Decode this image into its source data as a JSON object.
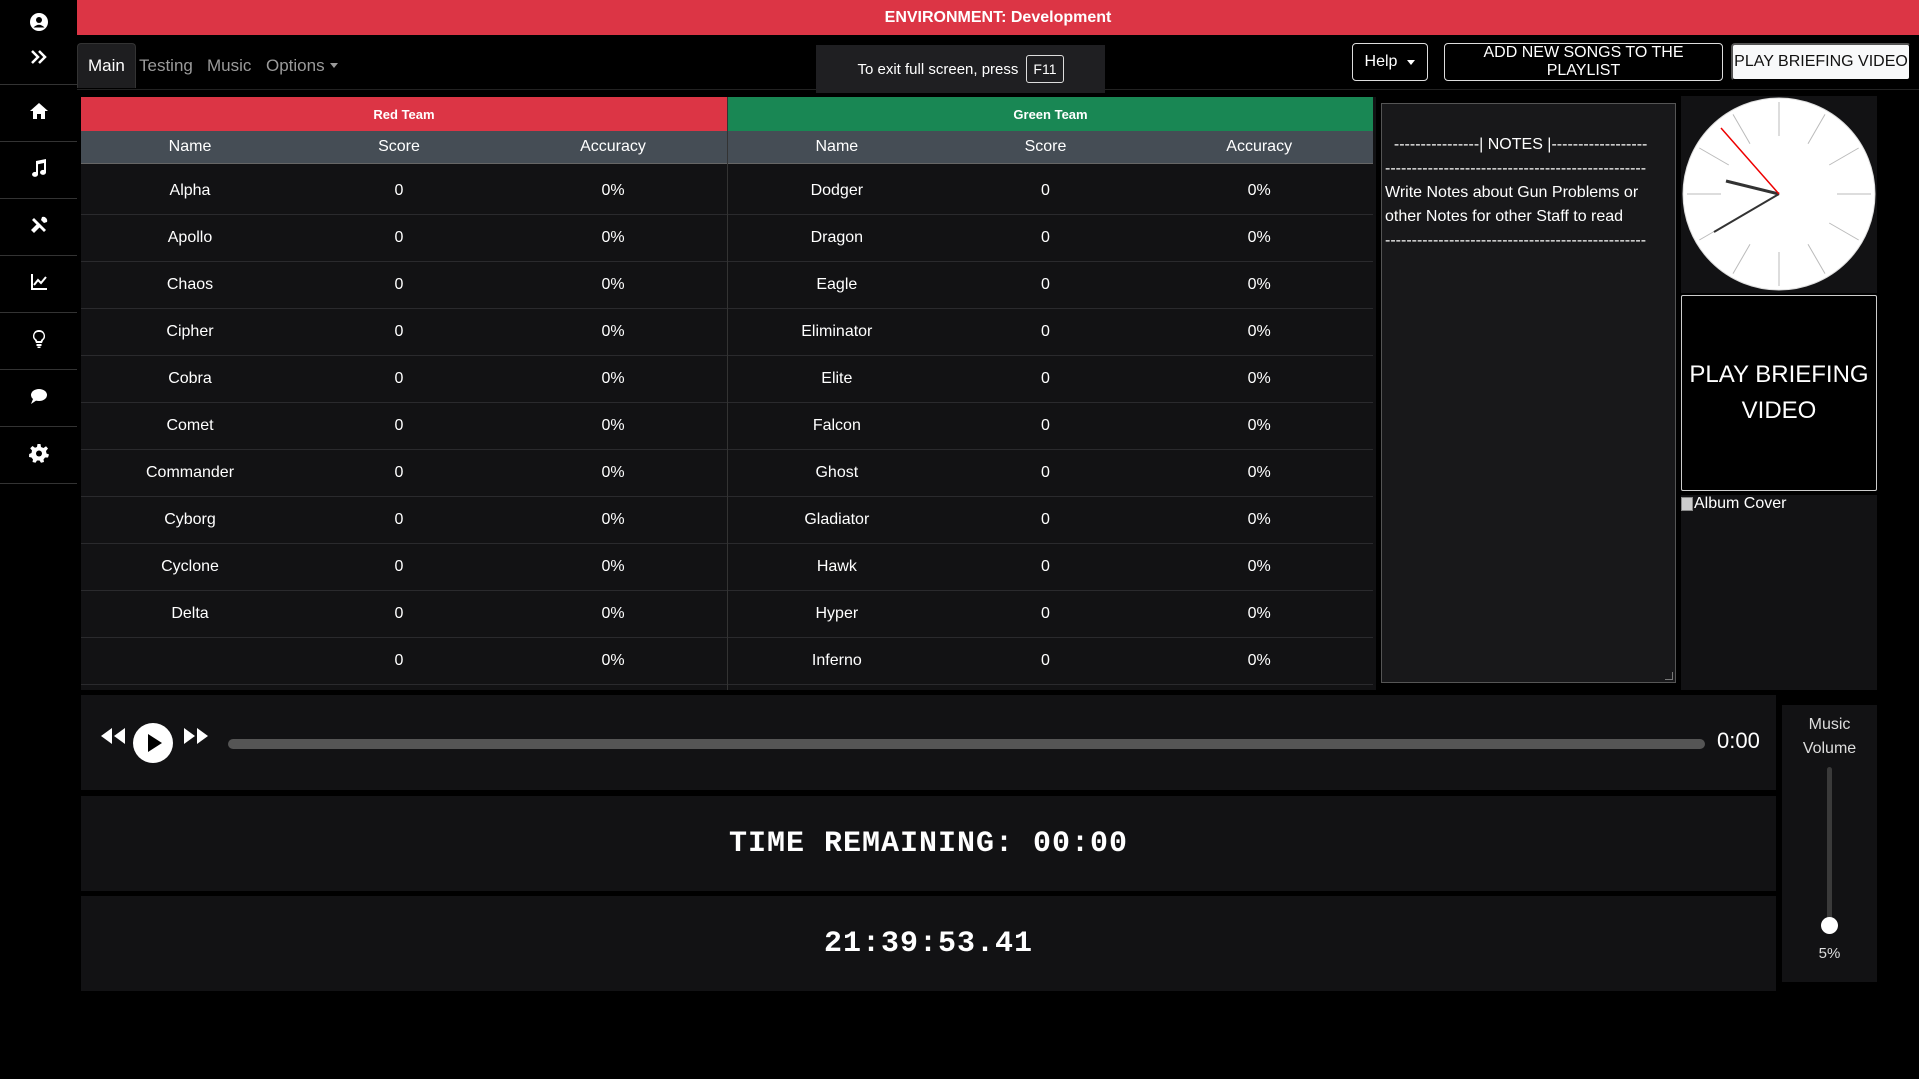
{
  "environment_banner": "ENVIRONMENT: Development",
  "nav": {
    "tabs": [
      "Main",
      "Testing",
      "Music"
    ],
    "options_label": "Options",
    "fullscreen_hint": "To exit full screen, press",
    "fullscreen_key": "F11",
    "help_label": "Help",
    "add_songs_label": "ADD NEW SONGS TO THE PLAYLIST",
    "play_briefing_label": "PLAY BRIEFING VIDEO"
  },
  "sidebar_icons": [
    "user-circle-icon",
    "double-chevron-right-icon",
    "home-icon",
    "music-icon",
    "tools-icon",
    "chart-line-icon",
    "lightbulb-icon",
    "chat-icon",
    "gear-icon"
  ],
  "teams": {
    "columns": [
      "Name",
      "Score",
      "Accuracy"
    ],
    "red": {
      "name": "Red Team",
      "color": "#dc3545",
      "players": [
        {
          "name": "Alpha",
          "score": "0",
          "accuracy": "0%"
        },
        {
          "name": "Apollo",
          "score": "0",
          "accuracy": "0%"
        },
        {
          "name": "Chaos",
          "score": "0",
          "accuracy": "0%"
        },
        {
          "name": "Cipher",
          "score": "0",
          "accuracy": "0%"
        },
        {
          "name": "Cobra",
          "score": "0",
          "accuracy": "0%"
        },
        {
          "name": "Comet",
          "score": "0",
          "accuracy": "0%"
        },
        {
          "name": "Commander",
          "score": "0",
          "accuracy": "0%"
        },
        {
          "name": "Cyborg",
          "score": "0",
          "accuracy": "0%"
        },
        {
          "name": "Cyclone",
          "score": "0",
          "accuracy": "0%"
        },
        {
          "name": "Delta",
          "score": "0",
          "accuracy": "0%"
        },
        {
          "name": "",
          "score": "0",
          "accuracy": "0%"
        }
      ]
    },
    "green": {
      "name": "Green Team",
      "color": "#198754",
      "players": [
        {
          "name": "Dodger",
          "score": "0",
          "accuracy": "0%"
        },
        {
          "name": "Dragon",
          "score": "0",
          "accuracy": "0%"
        },
        {
          "name": "Eagle",
          "score": "0",
          "accuracy": "0%"
        },
        {
          "name": "Eliminator",
          "score": "0",
          "accuracy": "0%"
        },
        {
          "name": "Elite",
          "score": "0",
          "accuracy": "0%"
        },
        {
          "name": "Falcon",
          "score": "0",
          "accuracy": "0%"
        },
        {
          "name": "Ghost",
          "score": "0",
          "accuracy": "0%"
        },
        {
          "name": "Gladiator",
          "score": "0",
          "accuracy": "0%"
        },
        {
          "name": "Hawk",
          "score": "0",
          "accuracy": "0%"
        },
        {
          "name": "Hyper",
          "score": "0",
          "accuracy": "0%"
        },
        {
          "name": "Inferno",
          "score": "0",
          "accuracy": "0%"
        }
      ]
    }
  },
  "notes": {
    "text": "----------------| NOTES |------------------\n-------------------------------------------------\nWrite Notes about Gun Problems or other Notes for other Staff to read\n-------------------------------------------------"
  },
  "briefing_panel_label": "PLAY BRIEFING VIDEO",
  "album_cover_alt": "Album Cover",
  "player": {
    "elapsed": "0:00",
    "progress": 0
  },
  "volume": {
    "label": "Music Volume",
    "percent_text": "5%",
    "value": 0.05
  },
  "time_remaining": "TIME REMAINING: 00:00",
  "current_time": "21:39:53.41"
}
